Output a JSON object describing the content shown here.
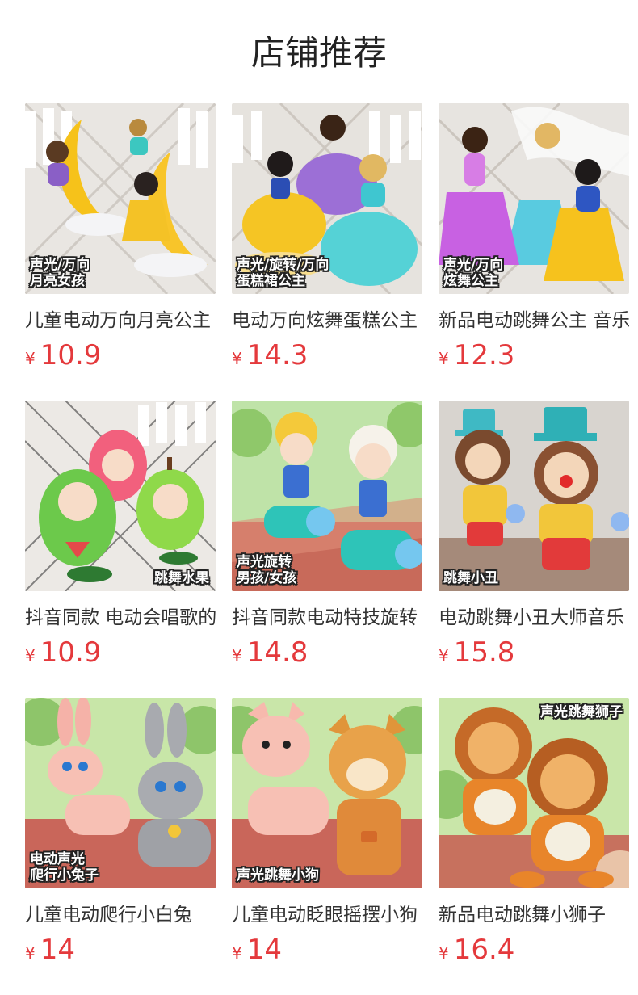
{
  "section": {
    "title": "店铺推荐"
  },
  "colors": {
    "price": "#e4393c",
    "title": "#222222",
    "text": "#333333"
  },
  "products": [
    {
      "name": "儿童电动万向月亮公主",
      "currency": "¥",
      "price": "10.9",
      "tag": "声光/万向\n月亮女孩",
      "image": "moon-princess-toy"
    },
    {
      "name": "电动万向炫舞蛋糕公主",
      "currency": "¥",
      "price": "14.3",
      "tag": "声光/旋转/万向\n蛋糕裙公主",
      "image": "cake-dress-princess-toy"
    },
    {
      "name": "新品电动跳舞公主 音乐",
      "currency": "¥",
      "price": "12.3",
      "tag": "声光/万向\n炫舞公主",
      "image": "dancing-princess-toy"
    },
    {
      "name": "抖音同款 电动会唱歌的",
      "currency": "¥",
      "price": "10.9",
      "tag": "跳舞水果",
      "image": "fruit-doll-toy"
    },
    {
      "name": "抖音同款电动特技旋转",
      "currency": "¥",
      "price": "14.8",
      "tag": "声光旋转\n男孩/女孩",
      "image": "balance-car-kids-toy"
    },
    {
      "name": "电动跳舞小丑大师音乐",
      "currency": "¥",
      "price": "15.8",
      "tag": "跳舞小丑",
      "image": "dancing-clown-toy"
    },
    {
      "name": "儿童电动爬行小白兔",
      "currency": "¥",
      "price": "14",
      "tag": "电动声光\n爬行小兔子",
      "image": "crawling-rabbit-toy"
    },
    {
      "name": "儿童电动眨眼摇摆小狗",
      "currency": "¥",
      "price": "14",
      "tag": "声光跳舞小狗",
      "image": "dancing-dog-toy"
    },
    {
      "name": "新品电动跳舞小狮子",
      "currency": "¥",
      "price": "16.4",
      "tag": "声光跳舞狮子",
      "image": "dancing-lion-toy"
    }
  ]
}
